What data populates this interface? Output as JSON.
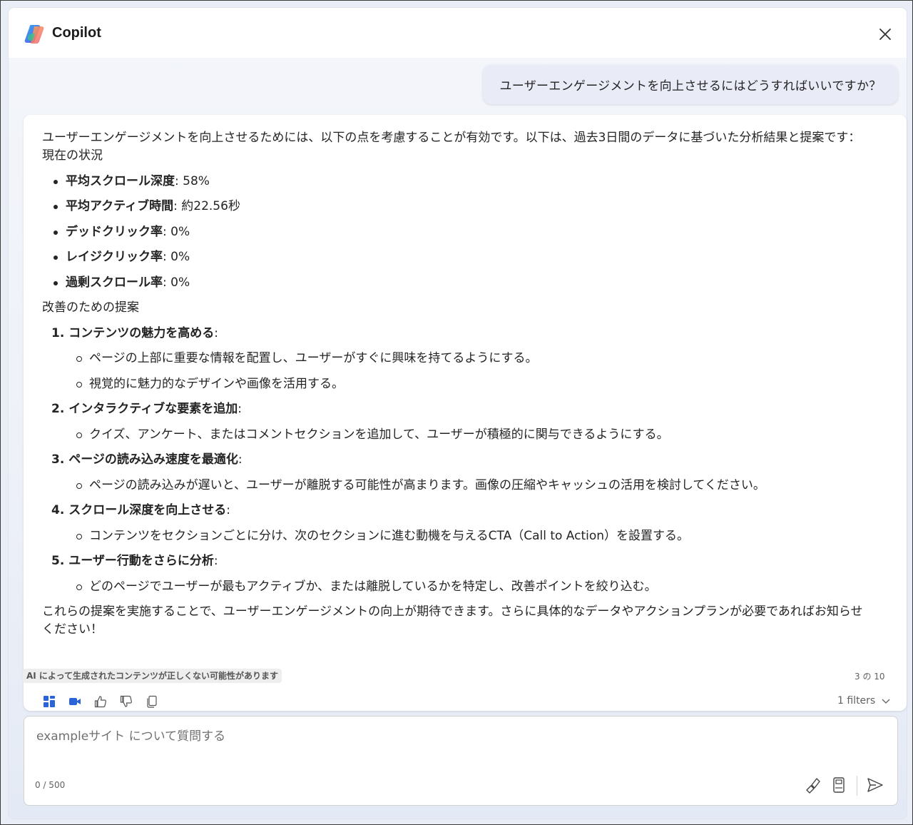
{
  "header": {
    "title": "Copilot",
    "logo_icon": "copilot-logo",
    "close_icon": "close-icon"
  },
  "conversation": {
    "user_message": "ユーザーエンゲージメントを向上させるにはどうすればいいですか？",
    "answer": {
      "intro": "ユーザーエンゲージメントを向上させるためには、以下の点を考慮することが有効です。以下は、過去3日間のデータに基づいた分析結果と提案です：",
      "current_heading": "現在の状況",
      "metrics": [
        {
          "label": "平均スクロール深度",
          "value": ": 58%"
        },
        {
          "label": "平均アクティブ時間",
          "value": ": 約22.56秒"
        },
        {
          "label": "デッドクリック率",
          "value": ": 0%"
        },
        {
          "label": "レイジクリック率",
          "value": ": 0%"
        },
        {
          "label": "過剰スクロール率",
          "value": ": 0%"
        }
      ],
      "suggest_heading": "改善のための提案",
      "suggestions": [
        {
          "num": "1. ",
          "title": "コンテンツの魅力を高める",
          "colon": ":",
          "subs": [
            "ページの上部に重要な情報を配置し、ユーザーがすぐに興味を持てるようにする。",
            "視覚的に魅力的なデザインや画像を活用する。"
          ]
        },
        {
          "num": "2. ",
          "title": "インタラクティブな要素を追加",
          "colon": ":",
          "subs": [
            "クイズ、アンケート、またはコメントセクションを追加して、ユーザーが積極的に関与できるようにする。"
          ]
        },
        {
          "num": "3. ",
          "title": "ページの読み込み速度を最適化",
          "colon": ":",
          "subs": [
            "ページの読み込みが遅いと、ユーザーが離脱する可能性が高まります。画像の圧縮やキャッシュの活用を検討してください。"
          ]
        },
        {
          "num": "4. ",
          "title": "スクロール深度を向上させる",
          "colon": ":",
          "subs": [
            "コンテンツをセクションごとに分け、次のセクションに進む動機を与えるCTA（Call to Action）を設置する。"
          ]
        },
        {
          "num": "5. ",
          "title": "ユーザー行動をさらに分析",
          "colon": ":",
          "subs": [
            "どのページでユーザーが最もアクティブか、または離脱しているかを特定し、改善ポイントを絞り込む。"
          ]
        }
      ],
      "closing": "これらの提案を実施することで、ユーザーエンゲージメントの向上が期待できます。さらに具体的なデータやアクションプランが必要であればお知らせください！",
      "disclaimer": "AI によって生成されたコンテンツが正しくない可能性があります",
      "counter": "3 の 10",
      "filters_label": "1 filters"
    },
    "toolbar_icons": [
      "dashboard-icon",
      "video-icon",
      "thumbs-up-icon",
      "thumbs-down-icon",
      "copy-icon"
    ]
  },
  "composer": {
    "placeholder": "exampleサイト について質問する",
    "value": "",
    "char_count": "0 / 500",
    "icons": [
      "clear-icon",
      "notes-icon",
      "send-icon"
    ]
  },
  "colors": {
    "accent": "#2b63d9",
    "panel_bg": "#eef1f8",
    "user_bubble": "#e9ebf7"
  }
}
